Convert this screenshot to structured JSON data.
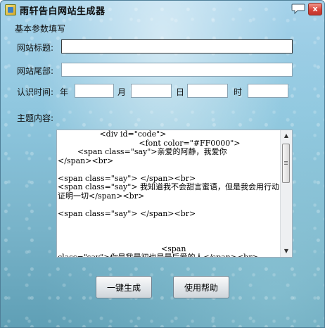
{
  "window": {
    "title": "雨轩告白网站生成器",
    "close_label": "x"
  },
  "form": {
    "group_title": "基本参数填写",
    "site_title_label": "网站标题:",
    "site_title_value": "",
    "site_footer_label": "网站尾部:",
    "site_footer_value": "",
    "date_label": "认识时间:",
    "year_label": "年",
    "year_value": "",
    "month_label": "月",
    "month_value": "",
    "day_label": "日",
    "day_value": "",
    "hour_label": "时",
    "hour_value": "",
    "content_label": "主题内容:",
    "content_value": "                 <div id=\"code\">\n                                 <font color=\"#FF0000\">\n        <span class=\"say\">亲爱的阿静，我爱你\n</span><br>\n\n<span class=\"say\"> </span><br>\n<span class=\"say\"> 我知道我不会甜言蜜语，但是我会用行动证明一切</span><br>\n\n<span class=\"say\"> </span><br>\n\n\n\n                                          <span\nclass=\"say\">你是我最初也是最后爱的人</span><br>"
  },
  "buttons": {
    "generate": "一键生成",
    "help": "使用帮助"
  },
  "icons": {
    "app": "app-icon",
    "help": "help-bubble-icon",
    "close": "close-icon"
  }
}
